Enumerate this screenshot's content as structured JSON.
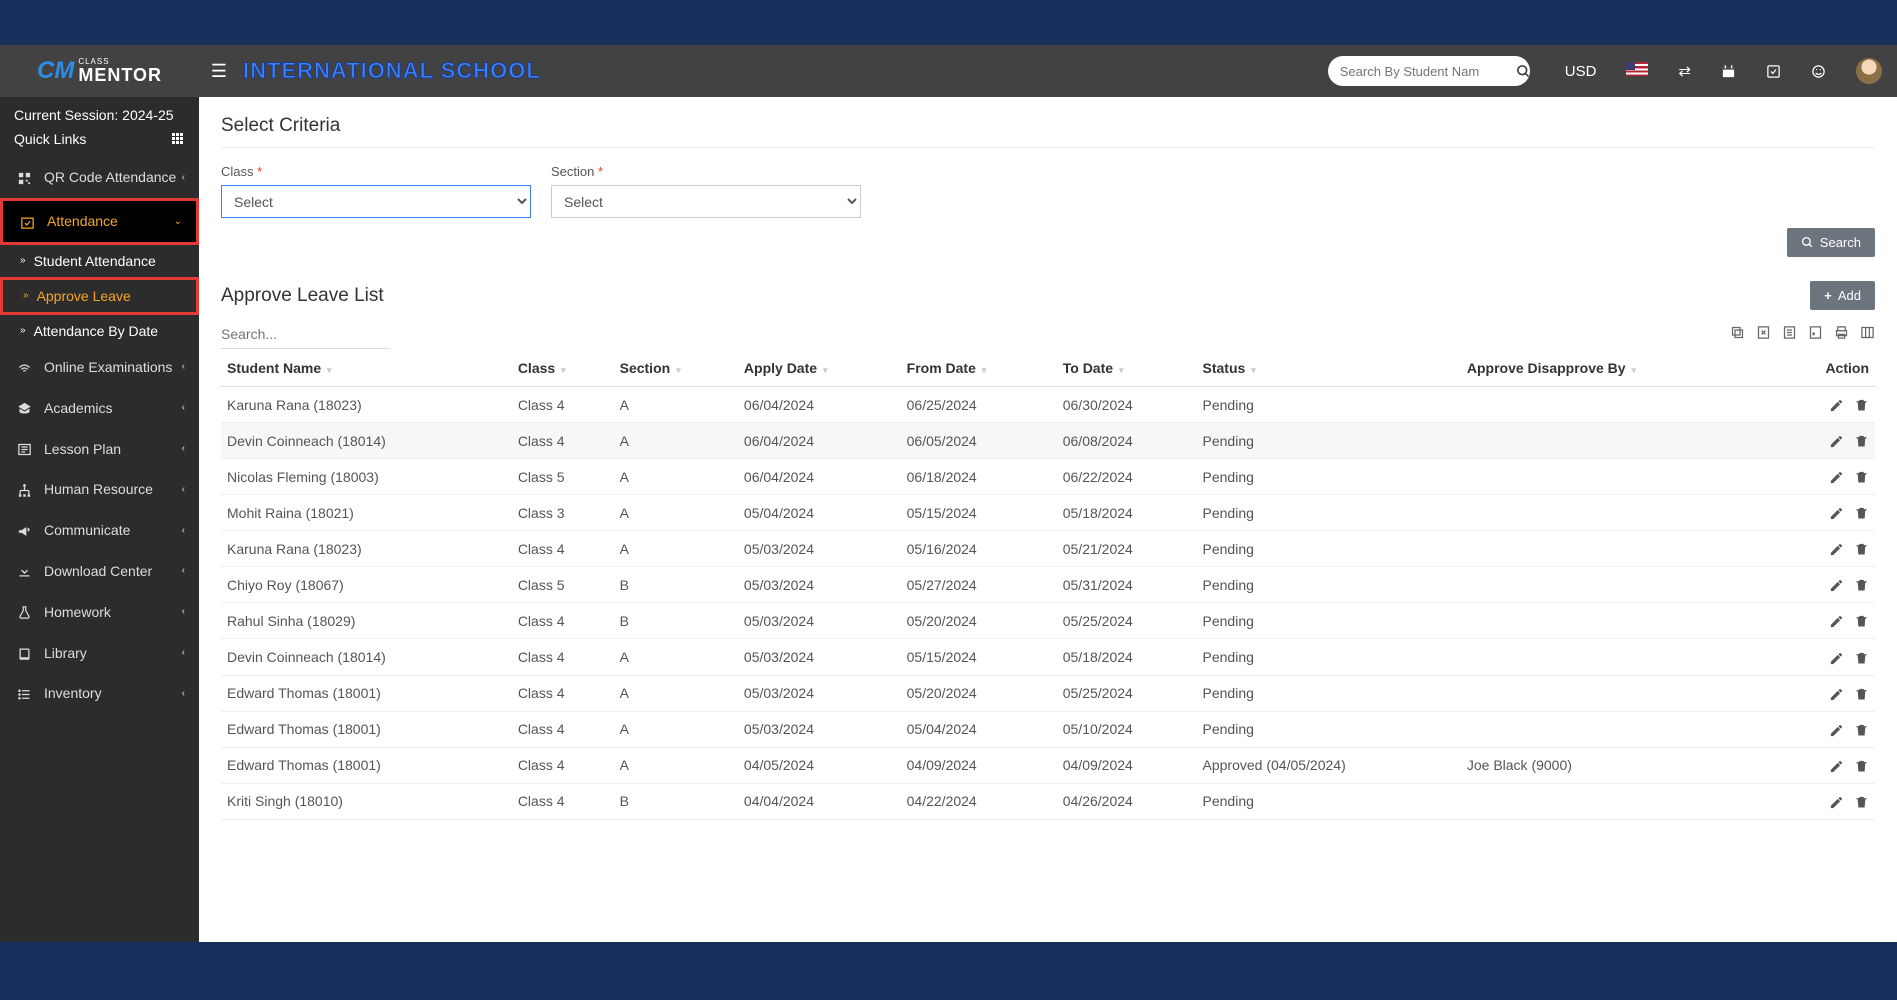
{
  "header": {
    "school_name": "INTERNATIONAL SCHOOL",
    "search_placeholder": "Search By Student Nam",
    "currency": "USD"
  },
  "sidebar": {
    "session": "Current Session: 2024-25",
    "quicklinks": "Quick Links",
    "items": [
      {
        "label": "QR Code Attendance",
        "icon": "qr"
      },
      {
        "label": "Attendance",
        "icon": "check-cal",
        "active": true,
        "expanded": true,
        "highlighted": true,
        "children": [
          {
            "label": "Student Attendance"
          },
          {
            "label": "Approve Leave",
            "highlighted": true
          },
          {
            "label": "Attendance By Date"
          }
        ]
      },
      {
        "label": "Online Examinations",
        "icon": "wifi"
      },
      {
        "label": "Academics",
        "icon": "cap"
      },
      {
        "label": "Lesson Plan",
        "icon": "news"
      },
      {
        "label": "Human Resource",
        "icon": "sitemap"
      },
      {
        "label": "Communicate",
        "icon": "bullhorn"
      },
      {
        "label": "Download Center",
        "icon": "download"
      },
      {
        "label": "Homework",
        "icon": "flask"
      },
      {
        "label": "Library",
        "icon": "book"
      },
      {
        "label": "Inventory",
        "icon": "list"
      }
    ]
  },
  "content": {
    "criteria_title": "Select Criteria",
    "class_label": "Class",
    "section_label": "Section",
    "select_placeholder": "Select",
    "search_btn": "Search",
    "list_title": "Approve Leave List",
    "add_btn": "Add",
    "table_search_placeholder": "Search...",
    "columns": [
      "Student Name",
      "Class",
      "Section",
      "Apply Date",
      "From Date",
      "To Date",
      "Status",
      "Approve Disapprove By",
      "Action"
    ],
    "rows": [
      {
        "name": "Karuna Rana (18023)",
        "class": "Class 4",
        "section": "A",
        "apply": "06/04/2024",
        "from": "06/25/2024",
        "to": "06/30/2024",
        "status": "Pending",
        "by": ""
      },
      {
        "name": "Devin Coinneach (18014)",
        "class": "Class 4",
        "section": "A",
        "apply": "06/04/2024",
        "from": "06/05/2024",
        "to": "06/08/2024",
        "status": "Pending",
        "by": "",
        "alt": true
      },
      {
        "name": "Nicolas Fleming (18003)",
        "class": "Class 5",
        "section": "A",
        "apply": "06/04/2024",
        "from": "06/18/2024",
        "to": "06/22/2024",
        "status": "Pending",
        "by": ""
      },
      {
        "name": "Mohit Raina (18021)",
        "class": "Class 3",
        "section": "A",
        "apply": "05/04/2024",
        "from": "05/15/2024",
        "to": "05/18/2024",
        "status": "Pending",
        "by": ""
      },
      {
        "name": "Karuna Rana (18023)",
        "class": "Class 4",
        "section": "A",
        "apply": "05/03/2024",
        "from": "05/16/2024",
        "to": "05/21/2024",
        "status": "Pending",
        "by": ""
      },
      {
        "name": "Chiyo Roy (18067)",
        "class": "Class 5",
        "section": "B",
        "apply": "05/03/2024",
        "from": "05/27/2024",
        "to": "05/31/2024",
        "status": "Pending",
        "by": ""
      },
      {
        "name": "Rahul Sinha (18029)",
        "class": "Class 4",
        "section": "B",
        "apply": "05/03/2024",
        "from": "05/20/2024",
        "to": "05/25/2024",
        "status": "Pending",
        "by": ""
      },
      {
        "name": "Devin Coinneach (18014)",
        "class": "Class 4",
        "section": "A",
        "apply": "05/03/2024",
        "from": "05/15/2024",
        "to": "05/18/2024",
        "status": "Pending",
        "by": ""
      },
      {
        "name": "Edward Thomas (18001)",
        "class": "Class 4",
        "section": "A",
        "apply": "05/03/2024",
        "from": "05/20/2024",
        "to": "05/25/2024",
        "status": "Pending",
        "by": ""
      },
      {
        "name": "Edward Thomas (18001)",
        "class": "Class 4",
        "section": "A",
        "apply": "05/03/2024",
        "from": "05/04/2024",
        "to": "05/10/2024",
        "status": "Pending",
        "by": ""
      },
      {
        "name": "Edward Thomas (18001)",
        "class": "Class 4",
        "section": "A",
        "apply": "04/05/2024",
        "from": "04/09/2024",
        "to": "04/09/2024",
        "status": "Approved (04/05/2024)",
        "by": "Joe Black (9000)"
      },
      {
        "name": "Kriti Singh (18010)",
        "class": "Class 4",
        "section": "B",
        "apply": "04/04/2024",
        "from": "04/22/2024",
        "to": "04/26/2024",
        "status": "Pending",
        "by": ""
      }
    ]
  }
}
